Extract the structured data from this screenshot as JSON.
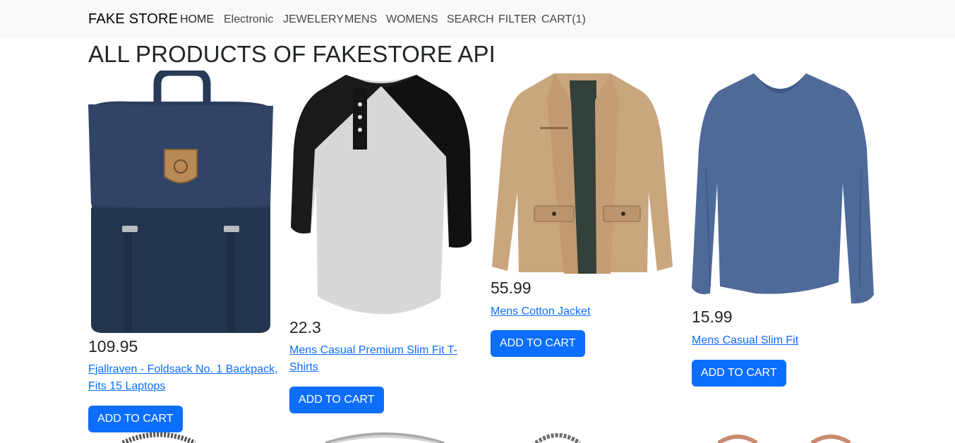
{
  "nav": {
    "brand": "FAKE STORE",
    "items": [
      "HOME",
      "Electronic",
      "JEWELERY",
      "MENS",
      "WOMENS",
      "SEARCH",
      "FILTER",
      "CART(1)"
    ]
  },
  "page_title": "ALL PRODUCTS OF FAKESTORE API",
  "products": [
    {
      "price": "109.95",
      "title": "Fjallraven - Foldsack No. 1 Backpack, Fits 15 Laptops",
      "button": "ADD TO CART",
      "image_icon": "backpack-image"
    },
    {
      "price": "22.3",
      "title": "Mens Casual Premium Slim Fit T-Shirts",
      "button": "ADD TO CART",
      "image_icon": "raglan-tshirt-image"
    },
    {
      "price": "55.99",
      "title": "Mens Cotton Jacket",
      "button": "ADD TO CART",
      "image_icon": "cotton-jacket-image"
    },
    {
      "price": "15.99",
      "title": "Mens Casual Slim Fit",
      "button": "ADD TO CART",
      "image_icon": "longsleeve-shirt-image"
    }
  ],
  "colors": {
    "accent": "#0d6efd",
    "navbar_bg": "#f8f9fa"
  }
}
